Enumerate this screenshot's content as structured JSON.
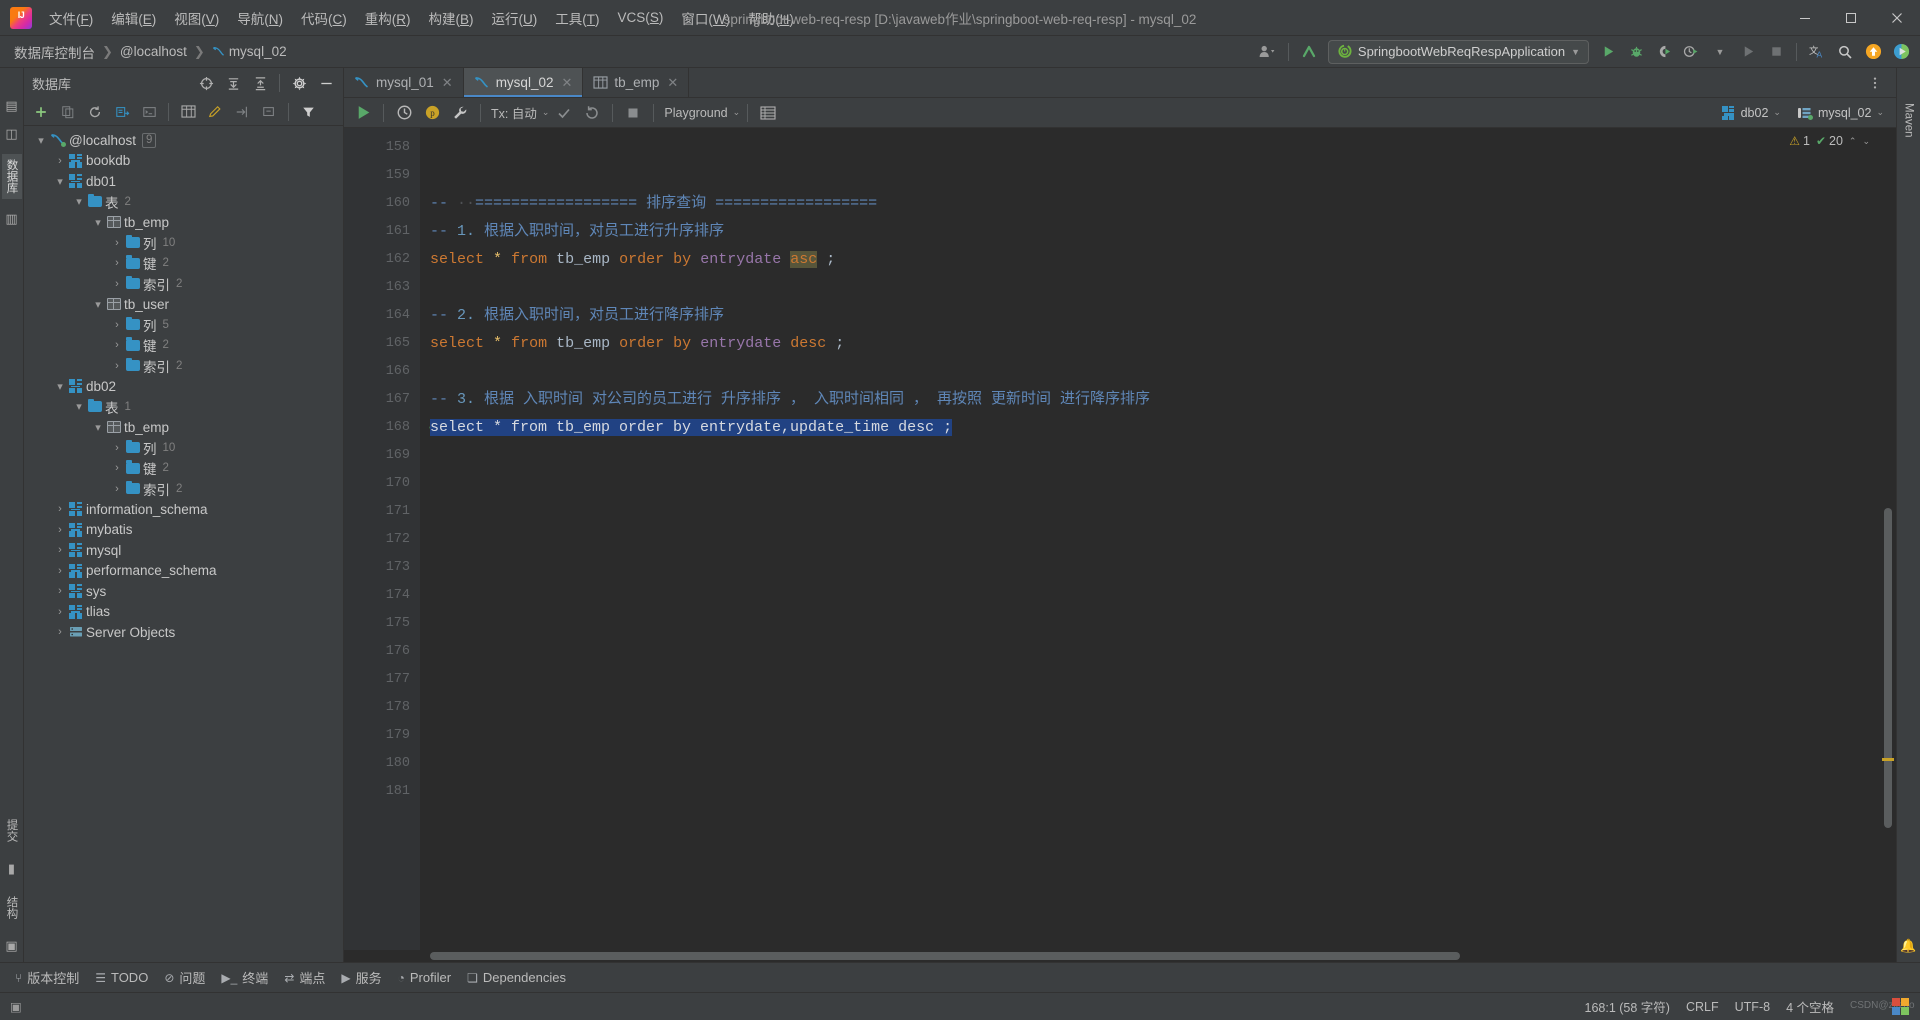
{
  "window": {
    "title": "springboot-web-req-resp [D:\\javaweb作业\\springboot-web-req-resp] - mysql_02",
    "minimize": "—",
    "maximize": "▭",
    "close": "✕"
  },
  "menubar": [
    {
      "label": "文件(F)",
      "name": "menu-file"
    },
    {
      "label": "编辑(E)",
      "name": "menu-edit"
    },
    {
      "label": "视图(V)",
      "name": "menu-view"
    },
    {
      "label": "导航(N)",
      "name": "menu-navigate"
    },
    {
      "label": "代码(C)",
      "name": "menu-code"
    },
    {
      "label": "重构(R)",
      "name": "menu-refactor"
    },
    {
      "label": "构建(B)",
      "name": "menu-build"
    },
    {
      "label": "运行(U)",
      "name": "menu-run"
    },
    {
      "label": "工具(T)",
      "name": "menu-tools"
    },
    {
      "label": "VCS(S)",
      "name": "menu-vcs"
    },
    {
      "label": "窗口(W)",
      "name": "menu-window"
    },
    {
      "label": "帮助(H)",
      "name": "menu-help"
    }
  ],
  "navbar": {
    "crumbs": [
      "数据库控制台",
      "@localhost",
      "mysql_02"
    ],
    "run_config": "SpringbootWebReqRespApplication",
    "icons": {
      "account": "account-icon",
      "updates": "update-arrow-icon",
      "run": "run-icon",
      "debug": "debug-icon",
      "run_coverage": "run-with-coverage-icon",
      "profiler": "profiler-icon",
      "run_disabled": "run-disabled-icon",
      "stop": "stop-icon",
      "translate": "translate-icon",
      "search": "search-everywhere-icon",
      "notification": "update-notification-icon",
      "next": "next-icon"
    }
  },
  "rail": {
    "left_tabs": [
      "项目",
      "结构",
      "收藏"
    ],
    "bottom_tabs": [
      "提交",
      "书签",
      "结构"
    ],
    "right_tabs": [
      "Maven",
      "数据库",
      "通知"
    ]
  },
  "database_panel": {
    "title": "数据库",
    "header_icons": [
      "expand-target-icon",
      "expand-all-icon",
      "collapse-all-icon",
      "settings-gear-icon",
      "hide-icon"
    ],
    "toolbar_icons": [
      "add-icon",
      "copy-icon",
      "refresh-icon",
      "jump-to-query-icon",
      "jump-to-console-icon",
      "data-editor-icon",
      "modify-icon",
      "import-icon",
      "export-icon",
      "filter-icon"
    ],
    "tree": [
      {
        "depth": 0,
        "arrow": "▾",
        "icon": "mysql-icon",
        "label": "@localhost",
        "count": "9",
        "name": "tree-node-localhost"
      },
      {
        "depth": 1,
        "arrow": "›",
        "icon": "schema-icon",
        "label": "bookdb",
        "count": "",
        "name": "tree-node-bookdb"
      },
      {
        "depth": 1,
        "arrow": "▾",
        "icon": "schema-icon",
        "label": "db01",
        "count": "",
        "name": "tree-node-db01"
      },
      {
        "depth": 2,
        "arrow": "▾",
        "icon": "folder-icon",
        "label": "表",
        "count": "2",
        "name": "tree-node-db01-tables"
      },
      {
        "depth": 3,
        "arrow": "▾",
        "icon": "table-icon",
        "label": "tb_emp",
        "count": "",
        "name": "tree-node-db01-tb-emp"
      },
      {
        "depth": 4,
        "arrow": "›",
        "icon": "folder-icon",
        "label": "列",
        "count": "10",
        "name": "tree-node-db01-tb-emp-columns"
      },
      {
        "depth": 4,
        "arrow": "›",
        "icon": "folder-icon",
        "label": "键",
        "count": "2",
        "name": "tree-node-db01-tb-emp-keys"
      },
      {
        "depth": 4,
        "arrow": "›",
        "icon": "folder-icon",
        "label": "索引",
        "count": "2",
        "name": "tree-node-db01-tb-emp-indexes"
      },
      {
        "depth": 3,
        "arrow": "▾",
        "icon": "table-icon",
        "label": "tb_user",
        "count": "",
        "name": "tree-node-db01-tb-user"
      },
      {
        "depth": 4,
        "arrow": "›",
        "icon": "folder-icon",
        "label": "列",
        "count": "5",
        "name": "tree-node-db01-tb-user-columns"
      },
      {
        "depth": 4,
        "arrow": "›",
        "icon": "folder-icon",
        "label": "键",
        "count": "2",
        "name": "tree-node-db01-tb-user-keys"
      },
      {
        "depth": 4,
        "arrow": "›",
        "icon": "folder-icon",
        "label": "索引",
        "count": "2",
        "name": "tree-node-db01-tb-user-indexes"
      },
      {
        "depth": 1,
        "arrow": "▾",
        "icon": "schema-icon",
        "label": "db02",
        "count": "",
        "name": "tree-node-db02"
      },
      {
        "depth": 2,
        "arrow": "▾",
        "icon": "folder-icon",
        "label": "表",
        "count": "1",
        "name": "tree-node-db02-tables"
      },
      {
        "depth": 3,
        "arrow": "▾",
        "icon": "table-icon",
        "label": "tb_emp",
        "count": "",
        "name": "tree-node-db02-tb-emp"
      },
      {
        "depth": 4,
        "arrow": "›",
        "icon": "folder-icon",
        "label": "列",
        "count": "10",
        "name": "tree-node-db02-tb-emp-columns"
      },
      {
        "depth": 4,
        "arrow": "›",
        "icon": "folder-icon",
        "label": "键",
        "count": "2",
        "name": "tree-node-db02-tb-emp-keys"
      },
      {
        "depth": 4,
        "arrow": "›",
        "icon": "folder-icon",
        "label": "索引",
        "count": "2",
        "name": "tree-node-db02-tb-emp-indexes"
      },
      {
        "depth": 1,
        "arrow": "›",
        "icon": "schema-icon",
        "label": "information_schema",
        "count": "",
        "name": "tree-node-information-schema"
      },
      {
        "depth": 1,
        "arrow": "›",
        "icon": "schema-icon",
        "label": "mybatis",
        "count": "",
        "name": "tree-node-mybatis"
      },
      {
        "depth": 1,
        "arrow": "›",
        "icon": "schema-icon",
        "label": "mysql",
        "count": "",
        "name": "tree-node-mysql"
      },
      {
        "depth": 1,
        "arrow": "›",
        "icon": "schema-icon",
        "label": "performance_schema",
        "count": "",
        "name": "tree-node-performance-schema"
      },
      {
        "depth": 1,
        "arrow": "›",
        "icon": "schema-icon",
        "label": "sys",
        "count": "",
        "name": "tree-node-sys"
      },
      {
        "depth": 1,
        "arrow": "›",
        "icon": "schema-icon",
        "label": "tlias",
        "count": "",
        "name": "tree-node-tlias"
      },
      {
        "depth": 1,
        "arrow": "›",
        "icon": "server-objects-icon",
        "label": "Server Objects",
        "count": "",
        "name": "tree-node-server-objects"
      }
    ]
  },
  "editor": {
    "tabs": [
      {
        "label": "mysql_01",
        "icon": "mysql-console-icon",
        "active": false,
        "name": "editor-tab-mysql-01"
      },
      {
        "label": "mysql_02",
        "icon": "mysql-console-icon",
        "active": true,
        "name": "editor-tab-mysql-02"
      },
      {
        "label": "tb_emp",
        "icon": "table-icon",
        "active": false,
        "name": "editor-tab-tb-emp"
      }
    ],
    "tab_close": "✕",
    "sql_toolbar": {
      "execute": "run-icon",
      "history": "history-icon",
      "playground_badge": "p",
      "wrench": "settings-wrench-icon",
      "tx_label": "Tx: 自动",
      "commit": "commit-check-icon",
      "rollback": "rollback-icon",
      "stop": "stop-icon",
      "schema_select": "Playground",
      "grid_icon": "data-grid-icon",
      "db_chip": "db02",
      "conn_chip": "mysql_02"
    },
    "inspections": {
      "warning_count": "1",
      "checked_count": "20",
      "up": "⌃",
      "down": "⌄"
    },
    "code_lines": [
      {
        "num": "158",
        "tokens": []
      },
      {
        "num": "159",
        "tokens": []
      },
      {
        "num": "160",
        "tokens": [
          {
            "t": "-- ",
            "c": "cm-blue"
          },
          {
            "t": "·",
            "c": "dotsep"
          },
          {
            "t": "·",
            "c": "dotsep"
          },
          {
            "t": "================== 排序查询 ==================",
            "c": "cm-blue"
          }
        ]
      },
      {
        "num": "161",
        "tokens": [
          {
            "t": "-- ",
            "c": "cm-blue"
          },
          {
            "t": "1.",
            "c": "cm-num"
          },
          {
            "t": " 根据入职时间，对员工进行升序排序",
            "c": "cm-blue"
          }
        ]
      },
      {
        "num": "162",
        "tokens": [
          {
            "t": "select",
            "c": "k"
          },
          {
            "t": " ",
            "c": "id"
          },
          {
            "t": "*",
            "c": "star"
          },
          {
            "t": " ",
            "c": "id"
          },
          {
            "t": "from",
            "c": "k"
          },
          {
            "t": " ",
            "c": "id"
          },
          {
            "t": "tb_emp",
            "c": "id"
          },
          {
            "t": " ",
            "c": "id"
          },
          {
            "t": "order",
            "c": "k"
          },
          {
            "t": " ",
            "c": "id"
          },
          {
            "t": "by",
            "c": "k"
          },
          {
            "t": " ",
            "c": "id"
          },
          {
            "t": "entrydate",
            "c": "col"
          },
          {
            "t": " ",
            "c": "id"
          },
          {
            "t": "asc",
            "c": "k hl"
          },
          {
            "t": " ;",
            "c": "id"
          }
        ]
      },
      {
        "num": "163",
        "tokens": []
      },
      {
        "num": "164",
        "tokens": [
          {
            "t": "-- ",
            "c": "cm-blue"
          },
          {
            "t": "2.",
            "c": "cm-num"
          },
          {
            "t": " 根据入职时间，对员工进行降序排序",
            "c": "cm-blue"
          }
        ]
      },
      {
        "num": "165",
        "tokens": [
          {
            "t": "select",
            "c": "k"
          },
          {
            "t": " ",
            "c": "id"
          },
          {
            "t": "*",
            "c": "star"
          },
          {
            "t": " ",
            "c": "id"
          },
          {
            "t": "from",
            "c": "k"
          },
          {
            "t": " ",
            "c": "id"
          },
          {
            "t": "tb_emp",
            "c": "id"
          },
          {
            "t": " ",
            "c": "id"
          },
          {
            "t": "order",
            "c": "k"
          },
          {
            "t": " ",
            "c": "id"
          },
          {
            "t": "by",
            "c": "k"
          },
          {
            "t": " ",
            "c": "id"
          },
          {
            "t": "entrydate",
            "c": "col"
          },
          {
            "t": " ",
            "c": "id"
          },
          {
            "t": "desc",
            "c": "k"
          },
          {
            "t": " ;",
            "c": "id"
          }
        ]
      },
      {
        "num": "166",
        "tokens": []
      },
      {
        "num": "167",
        "tokens": [
          {
            "t": "-- ",
            "c": "cm-blue"
          },
          {
            "t": "3.",
            "c": "cm-num"
          },
          {
            "t": " 根据 入职时间 对公司的员工进行 升序排序 ， 入职时间相同 ， 再按照 更新时间 进行降序排序",
            "c": "cm-blue"
          }
        ]
      },
      {
        "num": "168",
        "selected": true,
        "check": "✔",
        "tokens": [
          {
            "t": "select * from tb_emp order by entrydate,update_time desc ;",
            "c": "sel"
          }
        ]
      },
      {
        "num": "169",
        "tokens": []
      },
      {
        "num": "170",
        "tokens": []
      },
      {
        "num": "171",
        "tokens": []
      },
      {
        "num": "172",
        "tokens": []
      },
      {
        "num": "173",
        "tokens": []
      },
      {
        "num": "174",
        "tokens": []
      },
      {
        "num": "175",
        "tokens": []
      },
      {
        "num": "176",
        "tokens": []
      },
      {
        "num": "177",
        "tokens": []
      },
      {
        "num": "178",
        "tokens": []
      },
      {
        "num": "179",
        "tokens": []
      },
      {
        "num": "180",
        "tokens": []
      },
      {
        "num": "181",
        "tokens": []
      }
    ]
  },
  "bottom_bar": [
    {
      "label": "版本控制",
      "icon": "vcs-icon",
      "name": "bottom-tab-version-control"
    },
    {
      "label": "TODO",
      "icon": "todo-icon",
      "name": "bottom-tab-todo"
    },
    {
      "label": "问题",
      "icon": "problems-icon",
      "name": "bottom-tab-problems"
    },
    {
      "label": "终端",
      "icon": "terminal-icon",
      "name": "bottom-tab-terminal"
    },
    {
      "label": "端点",
      "icon": "endpoints-icon",
      "name": "bottom-tab-endpoints"
    },
    {
      "label": "服务",
      "icon": "services-icon",
      "name": "bottom-tab-services"
    },
    {
      "label": "Profiler",
      "icon": "profiler-icon",
      "name": "bottom-tab-profiler"
    },
    {
      "label": "Dependencies",
      "icon": "dependencies-icon",
      "name": "bottom-tab-dependencies"
    }
  ],
  "status_bar": {
    "caret": "168:1 (58 字符)",
    "line_sep": "CRLF",
    "encoding": "UTF-8",
    "indent": "4 个空格",
    "watermark": "CSDN@zkzao"
  },
  "colors": {
    "accent_blue": "#4a88c7",
    "selection": "#214283",
    "keyword": "#cc7832",
    "column": "#9876aa",
    "comment": "#5f87b8",
    "green": "#59a869",
    "panel_bg": "#3c3f41",
    "editor_bg": "#2b2b2b",
    "gutter_bg": "#313335",
    "tree_icon": "#3592c4"
  }
}
